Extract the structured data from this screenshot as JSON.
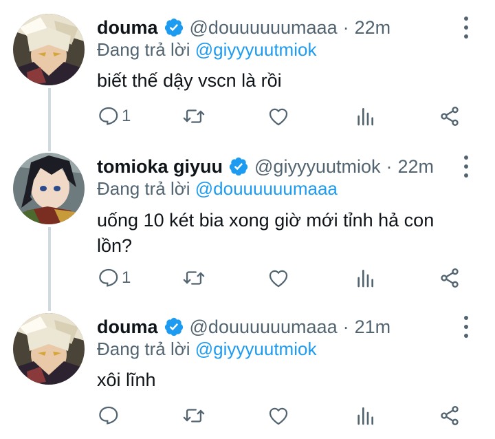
{
  "tweets": [
    {
      "name": "douma",
      "handle": "@douuuuuumaaa",
      "separator": "·",
      "time": "22m",
      "replying_prefix": "Đang trả lời ",
      "replying_to": "@giyyyuutmiok",
      "text": "biết thế dậy vscn là rồi",
      "reply_count": "1",
      "avatar": "douma-avatar"
    },
    {
      "name": "tomioka giyuu",
      "handle": "@giyyyuutmiok",
      "separator": "·",
      "time": "22m",
      "replying_prefix": "Đang trả lời ",
      "replying_to": "@douuuuuumaaa",
      "text": "uống 10 két bia xong giờ mới tỉnh hả con lồn?",
      "reply_count": "1",
      "avatar": "giyuu-avatar"
    },
    {
      "name": "douma",
      "handle": "@douuuuuumaaa",
      "separator": "·",
      "time": "21m",
      "replying_prefix": "Đang trả lời ",
      "replying_to": "@giyyyuutmiok",
      "text": "xôi lĩnh",
      "reply_count": "",
      "avatar": "douma-avatar"
    }
  ],
  "icons": {
    "verified": "verified-badge-icon",
    "more": "more-vertical-icon",
    "reply": "reply-icon",
    "retweet": "retweet-icon",
    "like": "heart-icon",
    "analytics": "analytics-icon",
    "share": "share-icon"
  },
  "colors": {
    "accent": "#1d9bf0",
    "secondary_text": "#536471",
    "thread_line": "#cfd9de"
  }
}
